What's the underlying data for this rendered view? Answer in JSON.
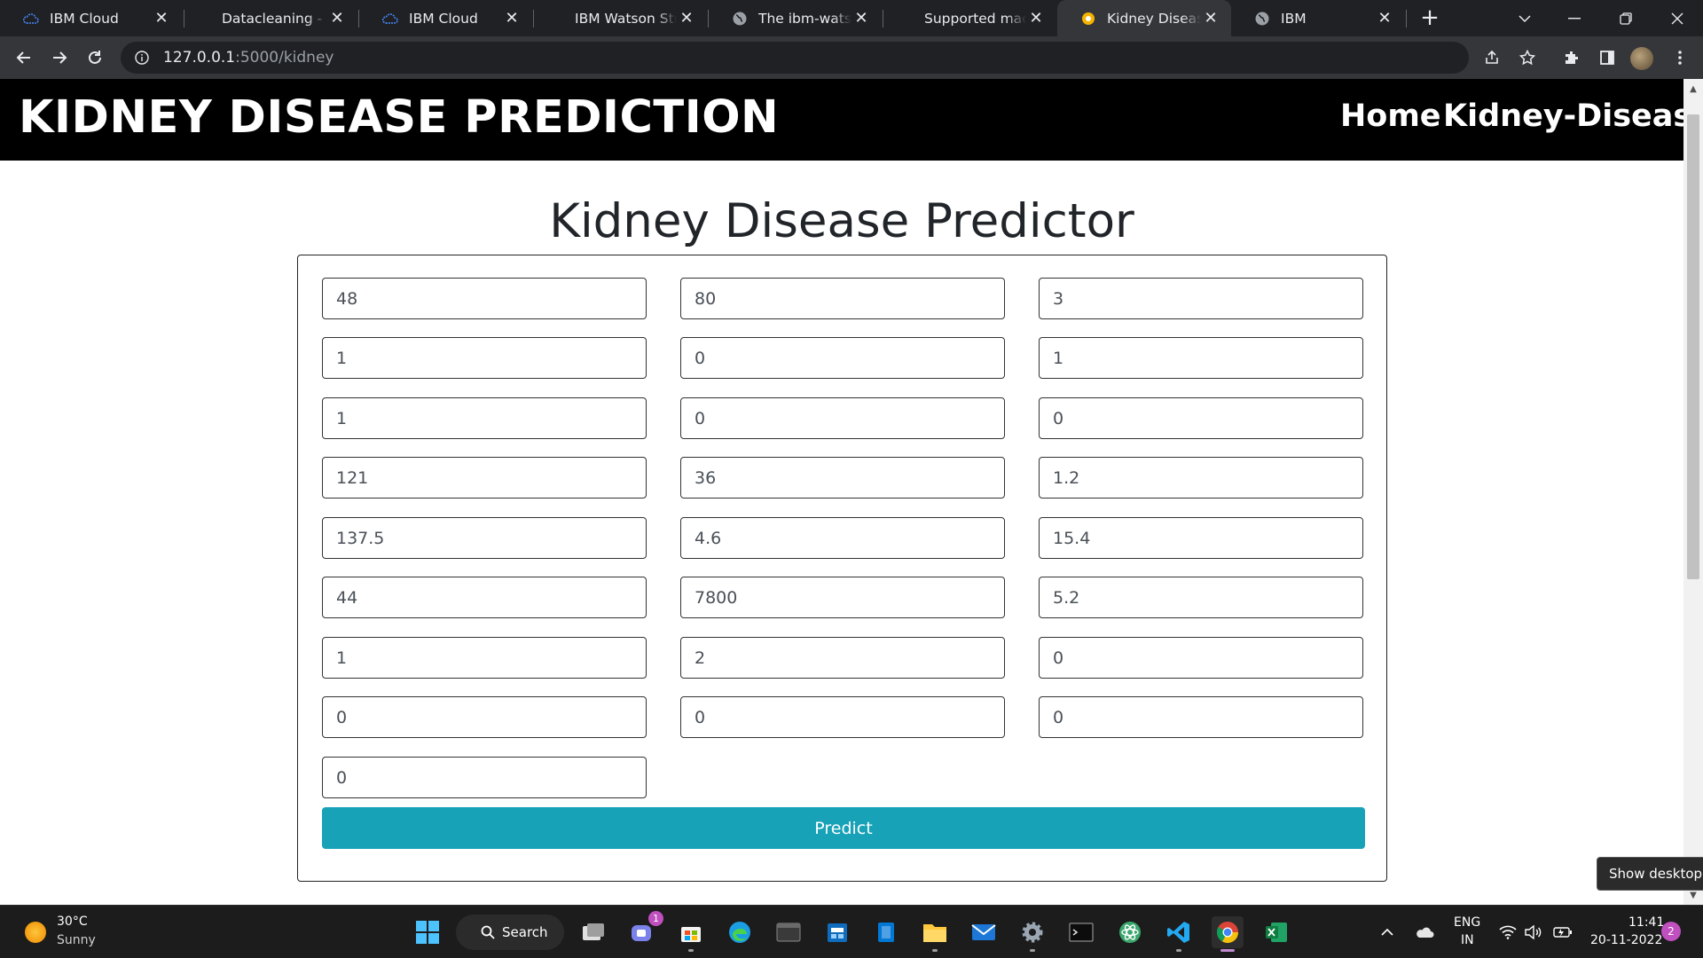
{
  "browser": {
    "tabs": [
      {
        "title": "IBM Cloud",
        "icon": "ibm-cloud-icon"
      },
      {
        "title": "Datacleaning - IBM",
        "icon": "none"
      },
      {
        "title": "IBM Cloud",
        "icon": "ibm-cloud-icon"
      },
      {
        "title": "IBM Watson Studio",
        "icon": "none"
      },
      {
        "title": "The ibm-watson-machine",
        "icon": "globe-icon"
      },
      {
        "title": "Supported machine",
        "icon": "none"
      },
      {
        "title": "Kidney Disease Prediction",
        "icon": "flask-icon",
        "active": true
      },
      {
        "title": "IBM",
        "icon": "globe-icon"
      }
    ],
    "url_host": "127.0.0.1",
    "url_path": ":5000/kidney"
  },
  "site": {
    "brand": "KIDNEY DISEASE PREDICTION",
    "nav": {
      "home": "Home",
      "kidney": "Kidney-Disease"
    }
  },
  "form": {
    "title": "Kidney Disease Predictor",
    "fields": [
      "48",
      "80",
      "3",
      "1",
      "0",
      "1",
      "1",
      "0",
      "0",
      "121",
      "36",
      "1.2",
      "137.5",
      "4.6",
      "15.4",
      "44",
      "7800",
      "5.2",
      "1",
      "2",
      "0",
      "0",
      "0",
      "0",
      "0"
    ],
    "submit_label": "Predict"
  },
  "tooltip": "Show desktop",
  "taskbar": {
    "weather_temp": "30°C",
    "weather_cond": "Sunny",
    "search_label": "Search",
    "lang_1": "ENG",
    "lang_2": "IN",
    "time": "11:41",
    "date": "20-11-2022",
    "notification_count": "2",
    "chat_badge": "1"
  },
  "colors": {
    "accent": "#17a2b8",
    "nav_bg": "#000000",
    "chrome_dark": "#202124",
    "chrome_toolbar": "#35363a"
  }
}
